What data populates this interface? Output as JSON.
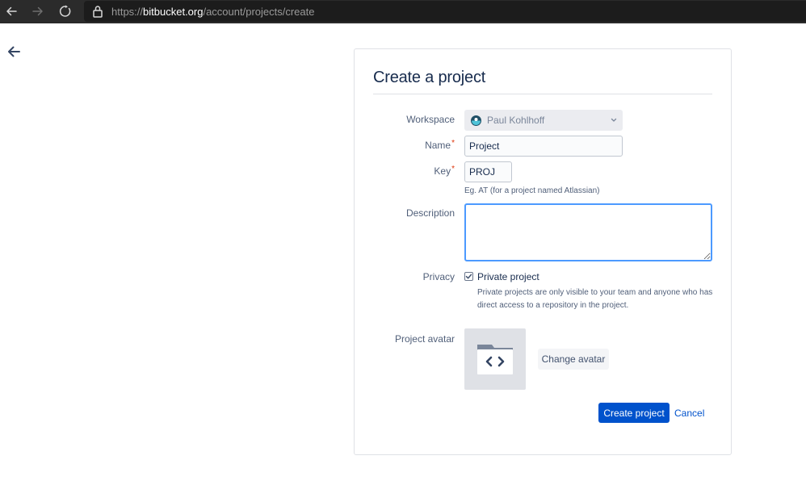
{
  "browser": {
    "url_scheme": "https://",
    "url_host": "bitbucket.org",
    "url_path": "/account/projects/create"
  },
  "form": {
    "title": "Create a project",
    "workspace_label": "Workspace",
    "workspace_value": "Paul Kohlhoff",
    "name_label": "Name",
    "name_value": "Project",
    "key_label": "Key",
    "key_value": "PROJ",
    "required_marker": "*",
    "key_hint": "Eg. AT (for a project named Atlassian)",
    "description_label": "Description",
    "description_value": "",
    "privacy_label": "Privacy",
    "private_checkbox_label": "Private project",
    "private_checked": true,
    "privacy_help": "Private projects are only visible to your team and anyone who has direct access to a repository in the project.",
    "avatar_label": "Project avatar",
    "change_avatar_label": "Change avatar",
    "create_label": "Create project",
    "cancel_label": "Cancel"
  },
  "icons": {
    "back": "arrow-left-icon",
    "forward": "arrow-right-icon",
    "reload": "reload-icon",
    "lock": "lock-icon",
    "workspace_avatar": "workspace-avatar-icon",
    "chevron": "chevron-down-icon",
    "project_avatar": "folder-code-icon",
    "checkbox": "check-icon"
  },
  "colors": {
    "primary": "#0052cc",
    "focus_ring": "#4c9aff",
    "required": "#de350b"
  }
}
